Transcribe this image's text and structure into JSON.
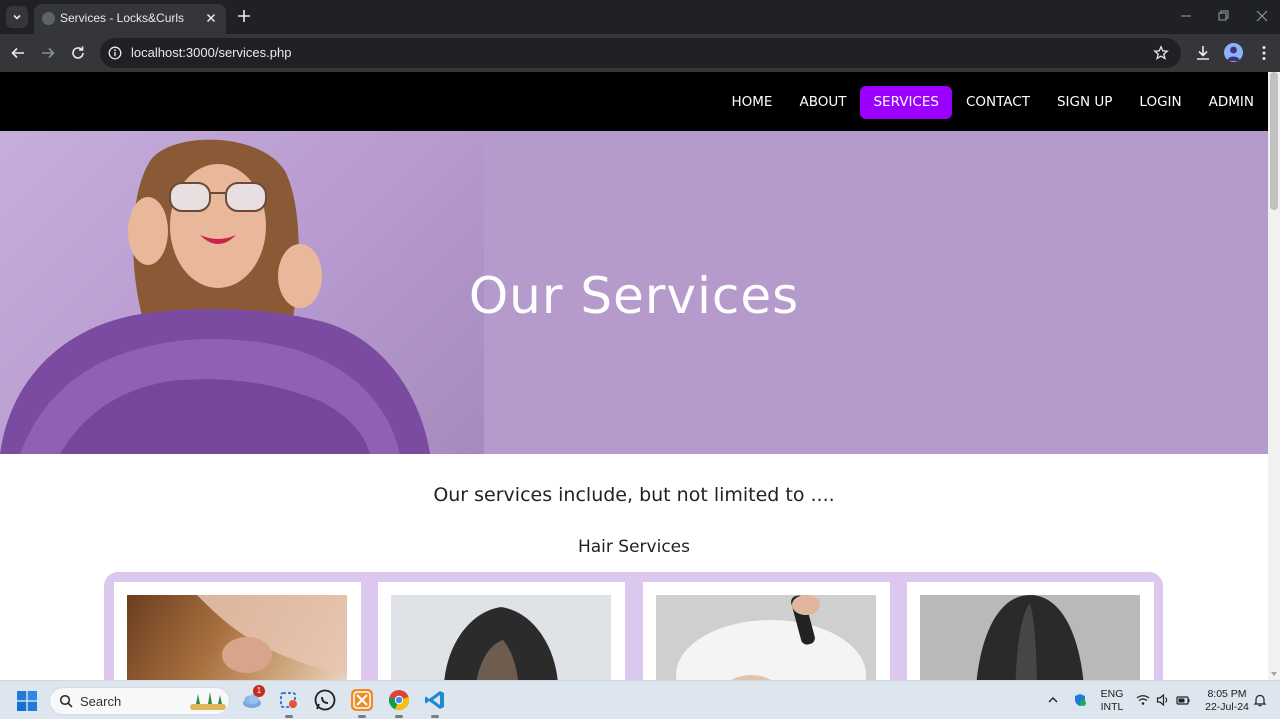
{
  "browser": {
    "tab_title": "Services - Locks&Curls",
    "url": "localhost:3000/services.php"
  },
  "site_nav": {
    "items": [
      {
        "label": "HOME"
      },
      {
        "label": "ABOUT"
      },
      {
        "label": "SERVICES",
        "active": true
      },
      {
        "label": "CONTACT"
      },
      {
        "label": "SIGN UP"
      },
      {
        "label": "LOGIN"
      },
      {
        "label": "ADMIN"
      }
    ],
    "active_color": "#9b00ff"
  },
  "hero": {
    "title": "Our Services",
    "background_color": "#b49bcb"
  },
  "content": {
    "intro": "Our services include, but not limited to ....",
    "section_title": "Hair Services",
    "card_band_color": "#dcc7ef"
  },
  "taskbar": {
    "search_label": "Search",
    "notification_count": "1",
    "language_line1": "ENG",
    "language_line2": "INTL",
    "time": "8:05 PM",
    "date": "22-Jul-24"
  }
}
